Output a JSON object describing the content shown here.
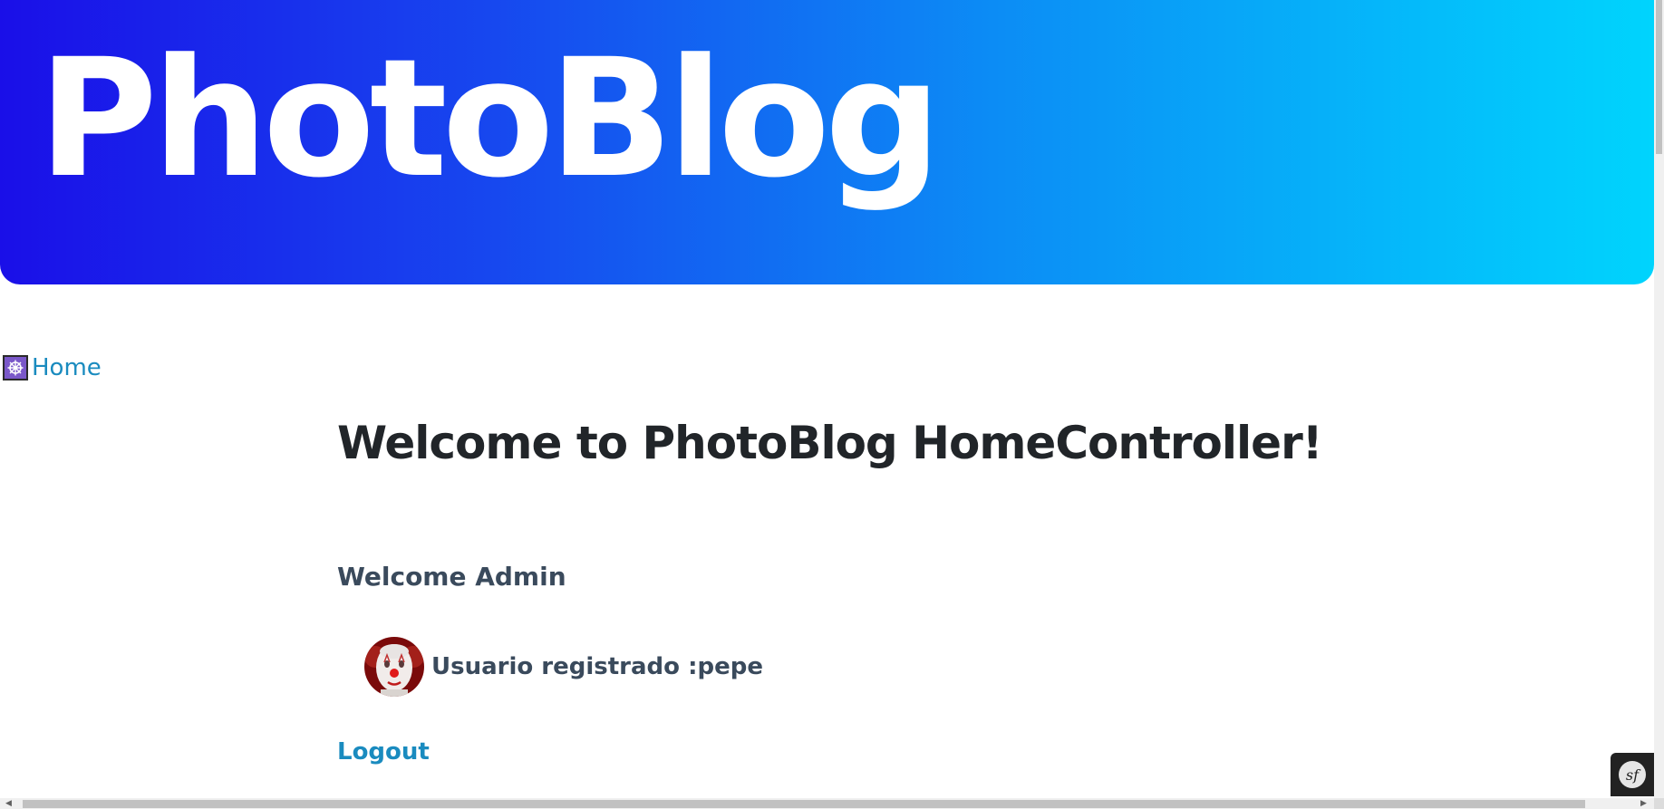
{
  "header": {
    "title": "PhotoBlog",
    "gradient_start": "#1a0fe8",
    "gradient_end": "#00d4fd"
  },
  "nav": {
    "icon": "helm-wheel-icon",
    "home_label": "Home",
    "link_color": "#1a8bbf"
  },
  "main": {
    "title": "Welcome to PhotoBlog HomeController!",
    "welcome_text": "Welcome Admin",
    "user_text": "Usuario registrado :pepe",
    "avatar_icon": "clown-avatar",
    "logout_label": "Logout"
  },
  "toolbar": {
    "logo_text": "sf",
    "arrow": "˅"
  },
  "scrollbars": {
    "left_arrow": "◀",
    "right_arrow": "▶"
  }
}
